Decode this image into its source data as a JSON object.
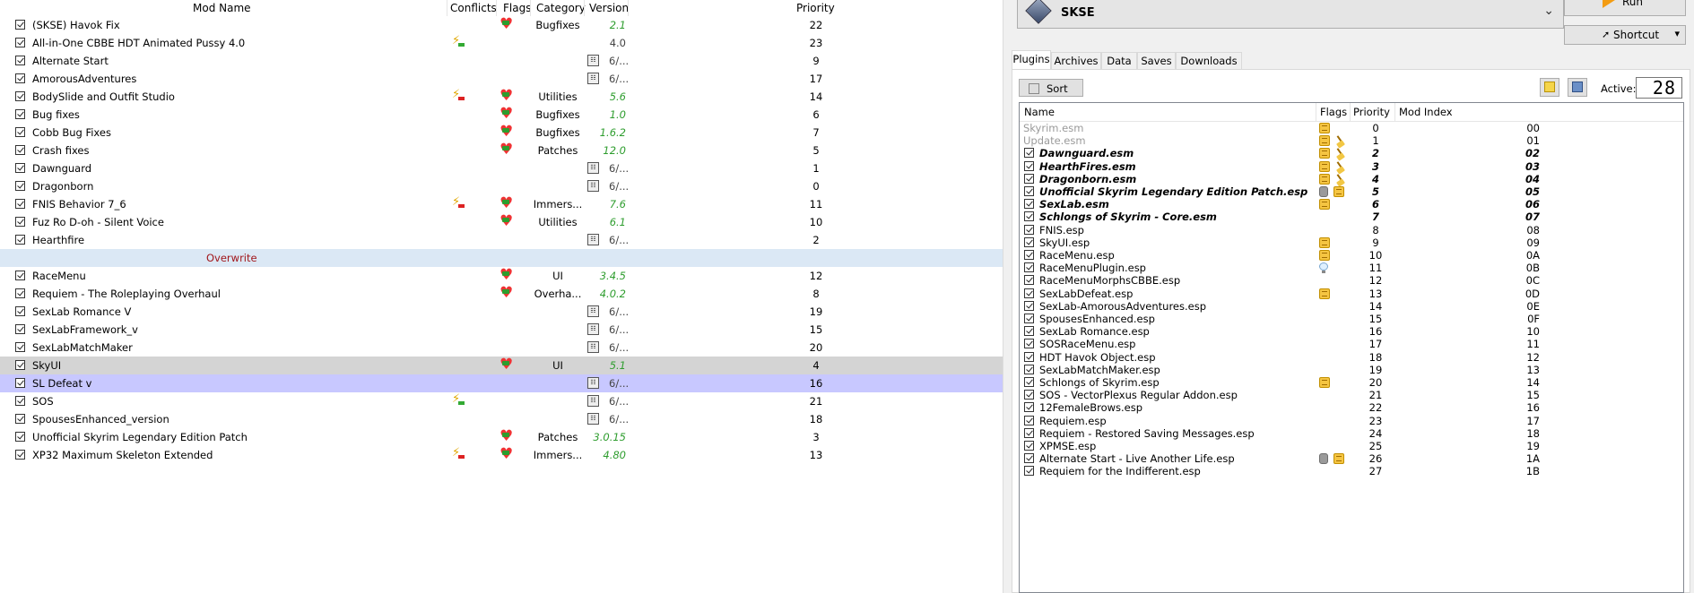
{
  "modlist": {
    "columns": {
      "name": "Mod Name",
      "conflicts": "Conflicts",
      "flags": "Flags",
      "category": "Category",
      "version": "Version",
      "priority": "Priority"
    },
    "rows": [
      {
        "name": "(SKSE) Havok Fix",
        "category": "Bugfixes",
        "version": "2.1",
        "priority": "22",
        "flag": true,
        "conflict": ""
      },
      {
        "name": "All-in-One CBBE HDT Animated Pussy 4.0",
        "category": "",
        "version": "4.0",
        "version_plain": true,
        "priority": "23",
        "flag": false,
        "conflict": "green"
      },
      {
        "name": "Alternate Start",
        "category": "",
        "version": "6/...",
        "vicon": true,
        "priority": "9",
        "flag": false,
        "conflict": ""
      },
      {
        "name": "AmorousAdventures",
        "category": "",
        "version": "6/...",
        "vicon": true,
        "priority": "17",
        "flag": false,
        "conflict": ""
      },
      {
        "name": "BodySlide and Outfit Studio",
        "category": "Utilities",
        "version": "5.6",
        "priority": "14",
        "flag": true,
        "conflict": "red"
      },
      {
        "name": "Bug fixes",
        "category": "Bugfixes",
        "version": "1.0",
        "priority": "6",
        "flag": true,
        "conflict": ""
      },
      {
        "name": "Cobb Bug Fixes",
        "category": "Bugfixes",
        "version": "1.6.2",
        "priority": "7",
        "flag": true,
        "conflict": ""
      },
      {
        "name": "Crash fixes",
        "category": "Patches",
        "version": "12.0",
        "priority": "5",
        "flag": true,
        "conflict": ""
      },
      {
        "name": "Dawnguard",
        "category": "",
        "version": "6/...",
        "vicon": true,
        "priority": "1",
        "flag": false,
        "conflict": ""
      },
      {
        "name": "Dragonborn",
        "category": "",
        "version": "6/...",
        "vicon": true,
        "priority": "0",
        "flag": false,
        "conflict": ""
      },
      {
        "name": "FNIS Behavior 7_6",
        "category": "Immers...",
        "version": "7.6",
        "priority": "11",
        "flag": true,
        "conflict": "red"
      },
      {
        "name": "Fuz Ro D-oh - Silent Voice",
        "category": "Utilities",
        "version": "6.1",
        "priority": "10",
        "flag": true,
        "conflict": ""
      },
      {
        "name": "Hearthfire",
        "category": "",
        "version": "6/...",
        "vicon": true,
        "priority": "2",
        "flag": false,
        "conflict": ""
      },
      {
        "overwrite": true,
        "name": "Overwrite"
      },
      {
        "name": "RaceMenu",
        "category": "UI",
        "version": "3.4.5",
        "priority": "12",
        "flag": true,
        "conflict": ""
      },
      {
        "name": "Requiem - The Roleplaying Overhaul",
        "category": "Overha...",
        "version": "4.0.2",
        "priority": "8",
        "flag": true,
        "conflict": ""
      },
      {
        "name": "SexLab Romance V",
        "category": "",
        "version": "6/...",
        "vicon": true,
        "priority": "19",
        "flag": false,
        "conflict": ""
      },
      {
        "name": "SexLabFramework_v",
        "category": "",
        "version": "6/...",
        "vicon": true,
        "priority": "15",
        "flag": false,
        "conflict": ""
      },
      {
        "name": "SexLabMatchMaker",
        "category": "",
        "version": "6/...",
        "vicon": true,
        "priority": "20",
        "flag": false,
        "conflict": ""
      },
      {
        "name": "SkyUI",
        "category": "UI",
        "version": "5.1",
        "priority": "4",
        "flag": true,
        "conflict": "",
        "highlight": "gray"
      },
      {
        "name": "SL Defeat v",
        "category": "",
        "version": "6/...",
        "vicon": true,
        "priority": "16",
        "flag": false,
        "conflict": "",
        "highlight": "blue"
      },
      {
        "name": "SOS",
        "category": "",
        "version": "6/...",
        "vicon": true,
        "priority": "21",
        "flag": false,
        "conflict": "green"
      },
      {
        "name": "SpousesEnhanced_version",
        "category": "",
        "version": "6/...",
        "vicon": true,
        "priority": "18",
        "flag": false,
        "conflict": ""
      },
      {
        "name": "Unofficial Skyrim Legendary Edition Patch",
        "category": "Patches",
        "version": "3.0.15",
        "priority": "3",
        "flag": true,
        "conflict": ""
      },
      {
        "name": "XP32 Maximum Skeleton Extended",
        "category": "Immers...",
        "version": "4.80",
        "priority": "13",
        "flag": true,
        "conflict": "red"
      }
    ]
  },
  "toolbar": {
    "executable": "SKSE",
    "run_label": "Run",
    "shortcut_label": "Shortcut"
  },
  "tabs": [
    "Plugins",
    "Archives",
    "Data",
    "Saves",
    "Downloads"
  ],
  "plugins_toolbar": {
    "sort_label": "Sort",
    "active_label": "Active:",
    "active_count": "28"
  },
  "plugins": {
    "columns": {
      "name": "Name",
      "flags": "Flags",
      "priority": "Priority",
      "mod_index": "Mod Index"
    },
    "rows": [
      {
        "name": "Skyrim.esm",
        "priority": "0",
        "index": "00",
        "type": "locked",
        "flags": [
          "esm"
        ]
      },
      {
        "name": "Update.esm",
        "priority": "1",
        "index": "01",
        "type": "locked",
        "flags": [
          "esm",
          "clean"
        ]
      },
      {
        "name": "Dawnguard.esm",
        "priority": "2",
        "index": "02",
        "type": "master",
        "flags": [
          "esm",
          "clean"
        ]
      },
      {
        "name": "HearthFires.esm",
        "priority": "3",
        "index": "03",
        "type": "master",
        "flags": [
          "esm",
          "clean"
        ]
      },
      {
        "name": "Dragonborn.esm",
        "priority": "4",
        "index": "04",
        "type": "master",
        "flags": [
          "esm",
          "clean"
        ]
      },
      {
        "name": "Unofficial Skyrim Legendary Edition Patch.esp",
        "priority": "5",
        "index": "05",
        "type": "master",
        "flags": [
          "gray",
          "esm"
        ]
      },
      {
        "name": "SexLab.esm",
        "priority": "6",
        "index": "06",
        "type": "master",
        "flags": [
          "esm"
        ]
      },
      {
        "name": "Schlongs of Skyrim - Core.esm",
        "priority": "7",
        "index": "07",
        "type": "master",
        "flags": []
      },
      {
        "name": "FNIS.esp",
        "priority": "8",
        "index": "08",
        "type": "normal",
        "flags": []
      },
      {
        "name": "SkyUI.esp",
        "priority": "9",
        "index": "09",
        "type": "normal",
        "flags": [
          "esm"
        ]
      },
      {
        "name": "RaceMenu.esp",
        "priority": "10",
        "index": "0A",
        "type": "normal",
        "flags": [
          "esm"
        ]
      },
      {
        "name": "RaceMenuPlugin.esp",
        "priority": "11",
        "index": "0B",
        "type": "normal",
        "flags": [
          "bulb"
        ]
      },
      {
        "name": "RaceMenuMorphsCBBE.esp",
        "priority": "12",
        "index": "0C",
        "type": "normal",
        "flags": []
      },
      {
        "name": "SexLabDefeat.esp",
        "priority": "13",
        "index": "0D",
        "type": "normal",
        "flags": [
          "esm"
        ]
      },
      {
        "name": "SexLab-AmorousAdventures.esp",
        "priority": "14",
        "index": "0E",
        "type": "normal",
        "flags": []
      },
      {
        "name": "SpousesEnhanced.esp",
        "priority": "15",
        "index": "0F",
        "type": "normal",
        "flags": []
      },
      {
        "name": "SexLab Romance.esp",
        "priority": "16",
        "index": "10",
        "type": "normal",
        "flags": []
      },
      {
        "name": "SOSRaceMenu.esp",
        "priority": "17",
        "index": "11",
        "type": "normal",
        "flags": []
      },
      {
        "name": "HDT Havok Object.esp",
        "priority": "18",
        "index": "12",
        "type": "normal",
        "flags": []
      },
      {
        "name": "SexLabMatchMaker.esp",
        "priority": "19",
        "index": "13",
        "type": "normal",
        "flags": []
      },
      {
        "name": "Schlongs of Skyrim.esp",
        "priority": "20",
        "index": "14",
        "type": "normal",
        "flags": [
          "esm"
        ]
      },
      {
        "name": "SOS - VectorPlexus Regular Addon.esp",
        "priority": "21",
        "index": "15",
        "type": "normal",
        "flags": []
      },
      {
        "name": "12FemaleBrows.esp",
        "priority": "22",
        "index": "16",
        "type": "normal",
        "flags": []
      },
      {
        "name": "Requiem.esp",
        "priority": "23",
        "index": "17",
        "type": "normal",
        "flags": []
      },
      {
        "name": "Requiem - Restored Saving Messages.esp",
        "priority": "24",
        "index": "18",
        "type": "normal",
        "flags": []
      },
      {
        "name": "XPMSE.esp",
        "priority": "25",
        "index": "19",
        "type": "normal",
        "flags": []
      },
      {
        "name": "Alternate Start - Live Another Life.esp",
        "priority": "26",
        "index": "1A",
        "type": "normal",
        "flags": [
          "gray",
          "esm"
        ]
      },
      {
        "name": "Requiem for the Indifferent.esp",
        "priority": "27",
        "index": "1B",
        "type": "normal",
        "flags": []
      }
    ]
  }
}
